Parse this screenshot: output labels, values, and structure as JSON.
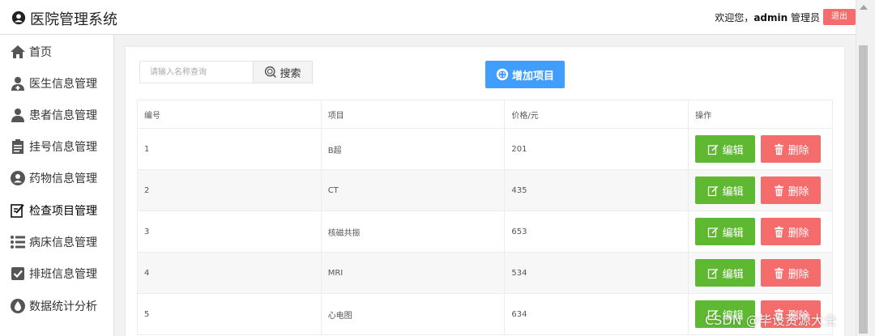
{
  "header": {
    "title": "医院管理系统",
    "welcome_prefix": "欢迎您，",
    "username": "admin",
    "role": " 管理员",
    "logout_label": "退出"
  },
  "sidebar": {
    "items": [
      {
        "label": "首页",
        "icon": "home-icon"
      },
      {
        "label": "医生信息管理",
        "icon": "doctor-icon"
      },
      {
        "label": "患者信息管理",
        "icon": "patient-icon"
      },
      {
        "label": "挂号信息管理",
        "icon": "register-icon"
      },
      {
        "label": "药物信息管理",
        "icon": "medicine-icon"
      },
      {
        "label": "检查项目管理",
        "icon": "check-icon"
      },
      {
        "label": "病床信息管理",
        "icon": "bed-list-icon"
      },
      {
        "label": "排班信息管理",
        "icon": "schedule-icon"
      },
      {
        "label": "数据统计分析",
        "icon": "stats-icon"
      }
    ],
    "active_index": 5
  },
  "toolbar": {
    "search_placeholder": "请输入名称查询",
    "search_label": "搜索",
    "add_label": "增加项目"
  },
  "table": {
    "headers": [
      "编号",
      "项目",
      "价格/元",
      "操作"
    ],
    "rows": [
      {
        "id": "1",
        "name": "B超",
        "price": "201"
      },
      {
        "id": "2",
        "name": "CT",
        "price": "435"
      },
      {
        "id": "3",
        "name": "核磁共振",
        "price": "653"
      },
      {
        "id": "4",
        "name": "MRI",
        "price": "534"
      },
      {
        "id": "5",
        "name": "心电图",
        "price": "634"
      }
    ],
    "edit_label": "编辑",
    "delete_label": "删除"
  },
  "watermark": "CSDN @毕设资源大全",
  "colors": {
    "primary": "#409eff",
    "success": "#5fb832",
    "danger": "#f56c6c"
  }
}
